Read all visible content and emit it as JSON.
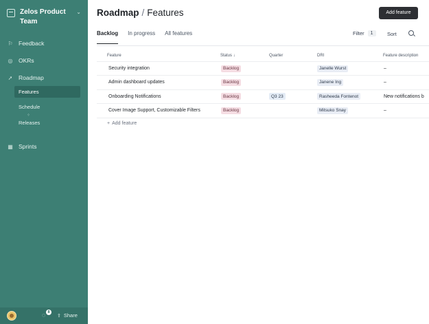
{
  "sidebar": {
    "team_name": "Zelos Product Team",
    "nav": {
      "feedback": "Feedback",
      "okrs": "OKRs",
      "roadmap": "Roadmap",
      "sprints": "Sprints"
    },
    "sub_items": {
      "features": "Features",
      "schedule": "Schedule",
      "releases": "Releases"
    },
    "footer": {
      "notification_count": "8",
      "share_label": "Share"
    }
  },
  "header": {
    "title_section": "Roadmap",
    "separator": "/",
    "title_page": "Features",
    "add_button_label": "Add feature"
  },
  "tabs": [
    {
      "label": "Backlog",
      "active": true
    },
    {
      "label": "In progress",
      "active": false
    },
    {
      "label": "All features",
      "active": false
    }
  ],
  "toolbar": {
    "filter_label": "Filter",
    "filter_count": "1",
    "sort_label": "Sort"
  },
  "table": {
    "columns": {
      "feature": "Feature",
      "status": "Status ↓",
      "quarter": "Quarter",
      "dri": "DRI",
      "description": "Feature description"
    },
    "rows": [
      {
        "feature": "Security integration",
        "status": "Backlog",
        "quarter": "",
        "dri": "Janelle Wurst",
        "description": "–"
      },
      {
        "feature": "Admin dashboard updates",
        "status": "Backlog",
        "quarter": "",
        "dri": "Janene Ing",
        "description": "–"
      },
      {
        "feature": "Onboarding Notifications",
        "status": "Backlog",
        "quarter": "Q3 23",
        "dri": "Rasheeda Fontenot",
        "description": "New notifications b"
      },
      {
        "feature": "Cover Image Support, Customizable Filters",
        "status": "Backlog",
        "quarter": "",
        "dri": "Mitsuko Snay",
        "description": "–"
      }
    ],
    "add_label": "Add feature"
  },
  "colors": {
    "sidebar_bg": "#3d7f74",
    "active_sub_bg": "#2f6960",
    "primary_button": "#2d2f33",
    "backlog_tag": "#f5dde3"
  },
  "icons": {
    "team": "workspace-icon",
    "feedback": "feedback-icon",
    "okrs": "target-icon",
    "roadmap": "rocket-icon",
    "sprints": "calendar-icon",
    "search": "search-icon",
    "bell": "bell-icon",
    "share": "share-icon"
  }
}
